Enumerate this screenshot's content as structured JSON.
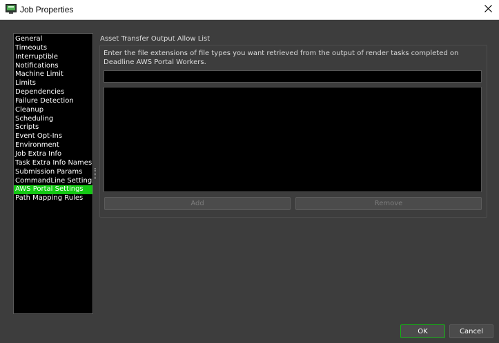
{
  "window": {
    "title": "Job Properties",
    "app_icon": "deadline-monitor-icon",
    "close_icon": "close-icon"
  },
  "sidebar": {
    "items": [
      {
        "label": "General",
        "selected": false
      },
      {
        "label": "Timeouts",
        "selected": false
      },
      {
        "label": "Interruptible",
        "selected": false
      },
      {
        "label": "Notifications",
        "selected": false
      },
      {
        "label": "Machine Limit",
        "selected": false
      },
      {
        "label": "Limits",
        "selected": false
      },
      {
        "label": "Dependencies",
        "selected": false
      },
      {
        "label": "Failure Detection",
        "selected": false
      },
      {
        "label": "Cleanup",
        "selected": false
      },
      {
        "label": "Scheduling",
        "selected": false
      },
      {
        "label": "Scripts",
        "selected": false
      },
      {
        "label": "Event Opt-Ins",
        "selected": false
      },
      {
        "label": "Environment",
        "selected": false
      },
      {
        "label": "Job Extra Info",
        "selected": false
      },
      {
        "label": "Task Extra Info Names",
        "selected": false
      },
      {
        "label": "Submission Params",
        "selected": false
      },
      {
        "label": "CommandLine Settings",
        "selected": false
      },
      {
        "label": "AWS Portal Settings",
        "selected": true
      },
      {
        "label": "Path Mapping Rules",
        "selected": false
      }
    ]
  },
  "panel": {
    "group_title": "Asset Transfer Output Allow List",
    "description": "Enter the file extensions of file types you want retrieved from the output of render tasks completed on Deadline AWS Portal Workers.",
    "extension_input_value": "",
    "extension_list": [],
    "add_label": "Add",
    "remove_label": "Remove"
  },
  "footer": {
    "ok_label": "OK",
    "cancel_label": "Cancel"
  },
  "colors": {
    "selection": "#14c814",
    "background": "#3d3d3d",
    "list_background": "#000000"
  }
}
